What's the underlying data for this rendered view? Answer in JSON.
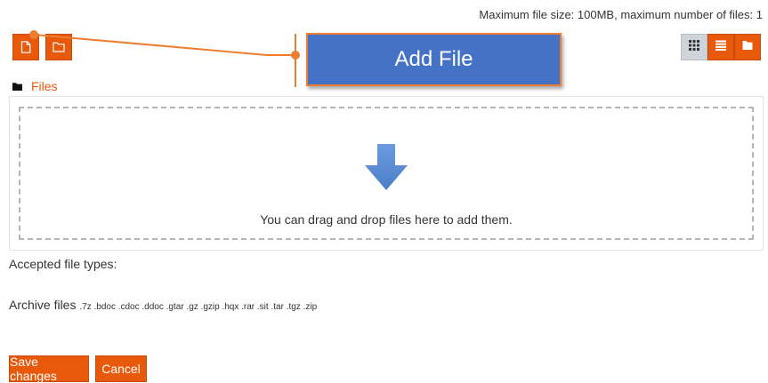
{
  "header": {
    "limits": "Maximum file size: 100MB, maximum number of files: 1"
  },
  "toolbar": {
    "add_file_icon": "file-icon",
    "create_folder_icon": "folder-icon"
  },
  "view_modes": {
    "items": [
      {
        "icon": "grid-icon",
        "active": true
      },
      {
        "icon": "list-icon",
        "active": false
      },
      {
        "icon": "tree-folder-icon",
        "active": false
      }
    ]
  },
  "path": {
    "label": "Files"
  },
  "dropzone": {
    "text": "You can drag and drop files here to add them."
  },
  "accepted": {
    "label": "Accepted file types:",
    "group_name": "Archive files",
    "extensions": ".7z .bdoc .cdoc .ddoc .gtar .gz .gzip .hqx .rar .sit .tar .tgz .zip"
  },
  "form": {
    "save_label": "Save changes",
    "cancel_label": "Cancel"
  },
  "callout": {
    "label": "Add File"
  },
  "colors": {
    "accent": "#e8590c",
    "callout_fill": "#4472c4",
    "callout_border": "#ed7d31",
    "drop_arrow": "#5b8fd6"
  }
}
